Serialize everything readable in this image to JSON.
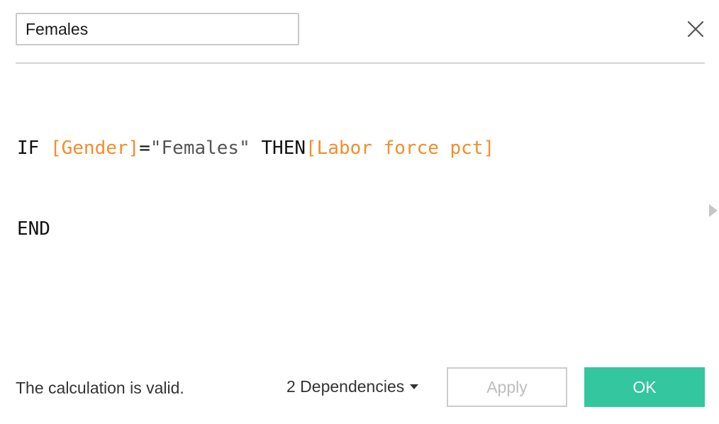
{
  "header": {
    "calc_name_value": "Females",
    "close_icon": "close-icon"
  },
  "editor": {
    "line1": {
      "kw_if": "IF ",
      "field_gender": "[Gender]",
      "operator": "=",
      "string_value": "\"Females\"",
      "kw_then": " THEN",
      "field_labor": "[Labor force pct]"
    },
    "line2": {
      "kw_end": "END"
    }
  },
  "side": {
    "expand_icon": "caret-right-icon"
  },
  "footer": {
    "status": "The calculation is valid.",
    "dependencies_label": "2 Dependencies",
    "apply_label": "Apply",
    "ok_label": "OK"
  },
  "colors": {
    "field": "#f28e2b",
    "ok_button": "#33c69f",
    "string": "#555555"
  }
}
